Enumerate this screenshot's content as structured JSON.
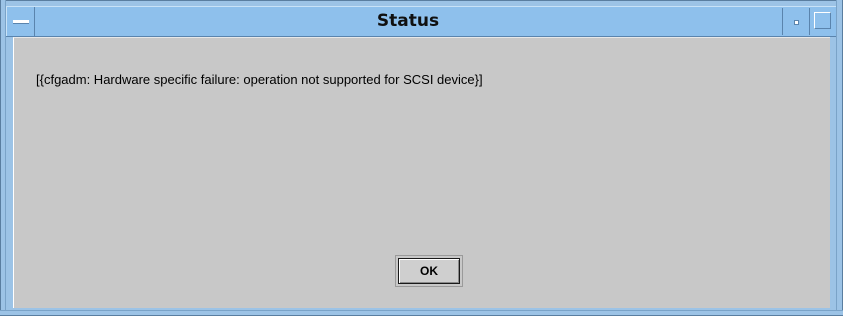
{
  "window": {
    "title": "Status"
  },
  "titlebar": {
    "menu_icon": "window-menu-icon",
    "minimize_icon": "minimize-icon",
    "maximize_icon": "maximize-icon"
  },
  "dialog": {
    "message": "[{cfgadm: Hardware specific failure: operation not supported for SCSI device}]",
    "ok_label": "OK"
  },
  "colors": {
    "titlebar": "#8ec0ec",
    "frame": "#9cc3e6",
    "client_background": "#c8c8c8"
  }
}
